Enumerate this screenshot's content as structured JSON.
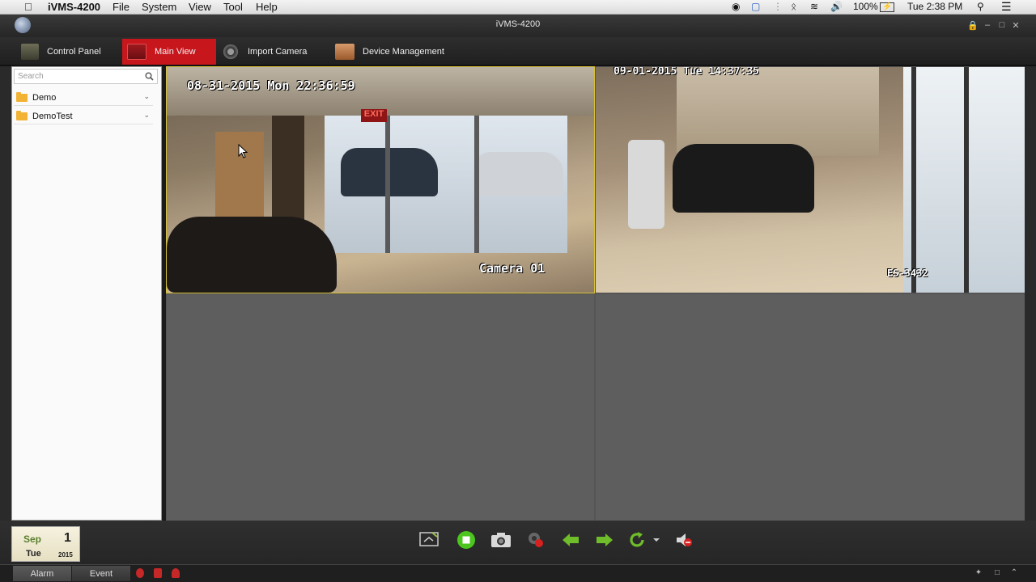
{
  "menubar": {
    "apple_icon": "apple-icon",
    "app_name": "iVMS-4200",
    "items": [
      "File",
      "System",
      "View",
      "Tool",
      "Help"
    ],
    "battery": "100%",
    "clock": "Tue 2:38 PM"
  },
  "window": {
    "title": "iVMS-4200"
  },
  "tabs": [
    {
      "label": "Control Panel",
      "icon": "control-panel-icon",
      "active": false
    },
    {
      "label": "Main View",
      "icon": "monitor-icon",
      "active": true
    },
    {
      "label": "Import Camera",
      "icon": "camera-icon",
      "active": false
    },
    {
      "label": "Device Management",
      "icon": "device-icon",
      "active": false
    }
  ],
  "sidebar": {
    "search_placeholder": "Search",
    "groups": [
      {
        "label": "Demo"
      },
      {
        "label": "DemoTest"
      }
    ]
  },
  "views": {
    "cam1": {
      "timestamp": "08-31-2015 Mon 22:36:59",
      "name": "Camera 01",
      "exit_sign": "EXIT"
    },
    "cam2": {
      "timestamp": "09-01-2015 Tue 14:37:35",
      "name": "ES-3432"
    }
  },
  "datebox": {
    "month": "Sep",
    "day": "1",
    "weekday": "Tue",
    "year": "2015"
  },
  "statusbar": {
    "tabs": [
      "Alarm",
      "Event"
    ]
  },
  "colors": {
    "accent": "#c8161d",
    "selection": "#d8c23a",
    "green": "#4cc61e"
  }
}
